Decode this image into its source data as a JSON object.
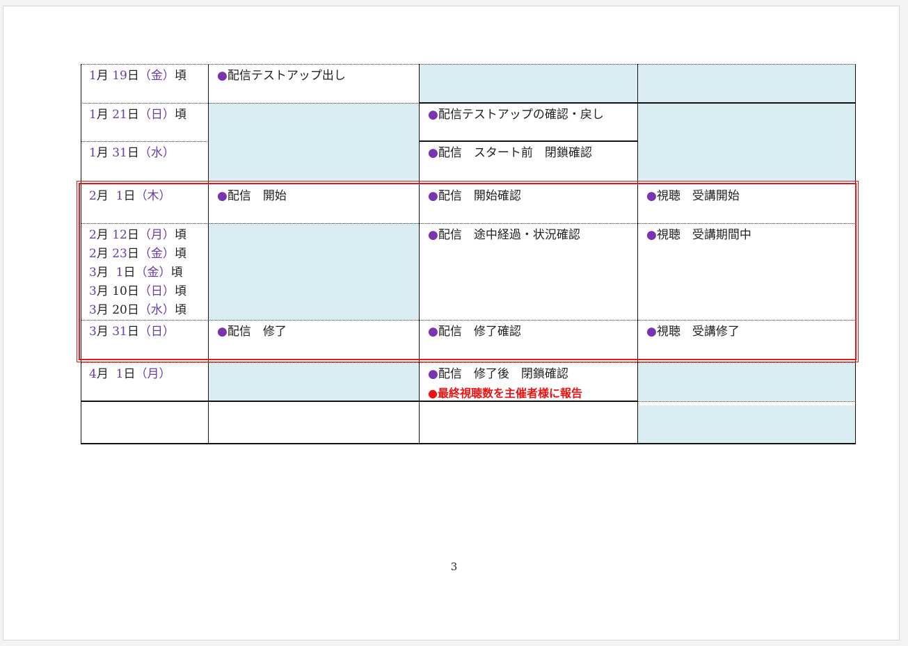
{
  "rows": [
    {
      "date": {
        "m": "1",
        "d": "19",
        "w": "金",
        "s": "頃"
      },
      "col1": "配信テストアップ出し",
      "col2": null,
      "col3": null
    },
    {
      "date": {
        "m": "1",
        "d": "21",
        "w": "日",
        "s": "頃"
      },
      "col1": null,
      "col2": "配信テストアップの確認・戻し",
      "col3": null
    },
    {
      "date": {
        "m": "1",
        "d": "31",
        "w": "水",
        "s": ""
      },
      "col1": null,
      "col2": "配信　スタート前　閉鎖確認",
      "col3": null
    },
    {
      "date": {
        "m": "2",
        "d": "1",
        "w": "木",
        "s": ""
      },
      "col1": "配信　開始",
      "col2": "配信　開始確認",
      "col3": "視聴　受講開始"
    },
    {
      "dates": [
        {
          "m": "2",
          "d": "12",
          "w": "月",
          "s": "頃"
        },
        {
          "m": "2",
          "d": "23",
          "w": "金",
          "s": "頃"
        },
        {
          "m": "3",
          "d": "1",
          "w": "金",
          "s": "頃"
        },
        {
          "m": "3",
          "d": "10",
          "w": "日",
          "s": "頃"
        },
        {
          "m": "3",
          "d": "20",
          "w": "水",
          "s": "頃"
        }
      ],
      "col1": null,
      "col2": "配信　途中経過・状況確認",
      "col3": "視聴　受講期間中"
    },
    {
      "date": {
        "m": "3",
        "d": "31",
        "w": "日",
        "s": ""
      },
      "col1": "配信　修了",
      "col2": "配信　修了確認",
      "col3": "視聴　受講修了"
    },
    {
      "date": {
        "m": "4",
        "d": "1",
        "w": "月",
        "s": ""
      },
      "col1": null,
      "col2": "配信　修了後　閉鎖確認",
      "col2_alert": "最終視聴数を主催者様に報告",
      "col3": null
    }
  ],
  "labels": {
    "month": "月",
    "day": "日",
    "bullet": "●"
  },
  "page_number": "3",
  "colors": {
    "cell_fill": "#daedf3",
    "date_accent": "#6a3aa8",
    "bullet": "#7a34b0",
    "alert": "#ee1111",
    "highlight_border": "#e01a1a"
  }
}
